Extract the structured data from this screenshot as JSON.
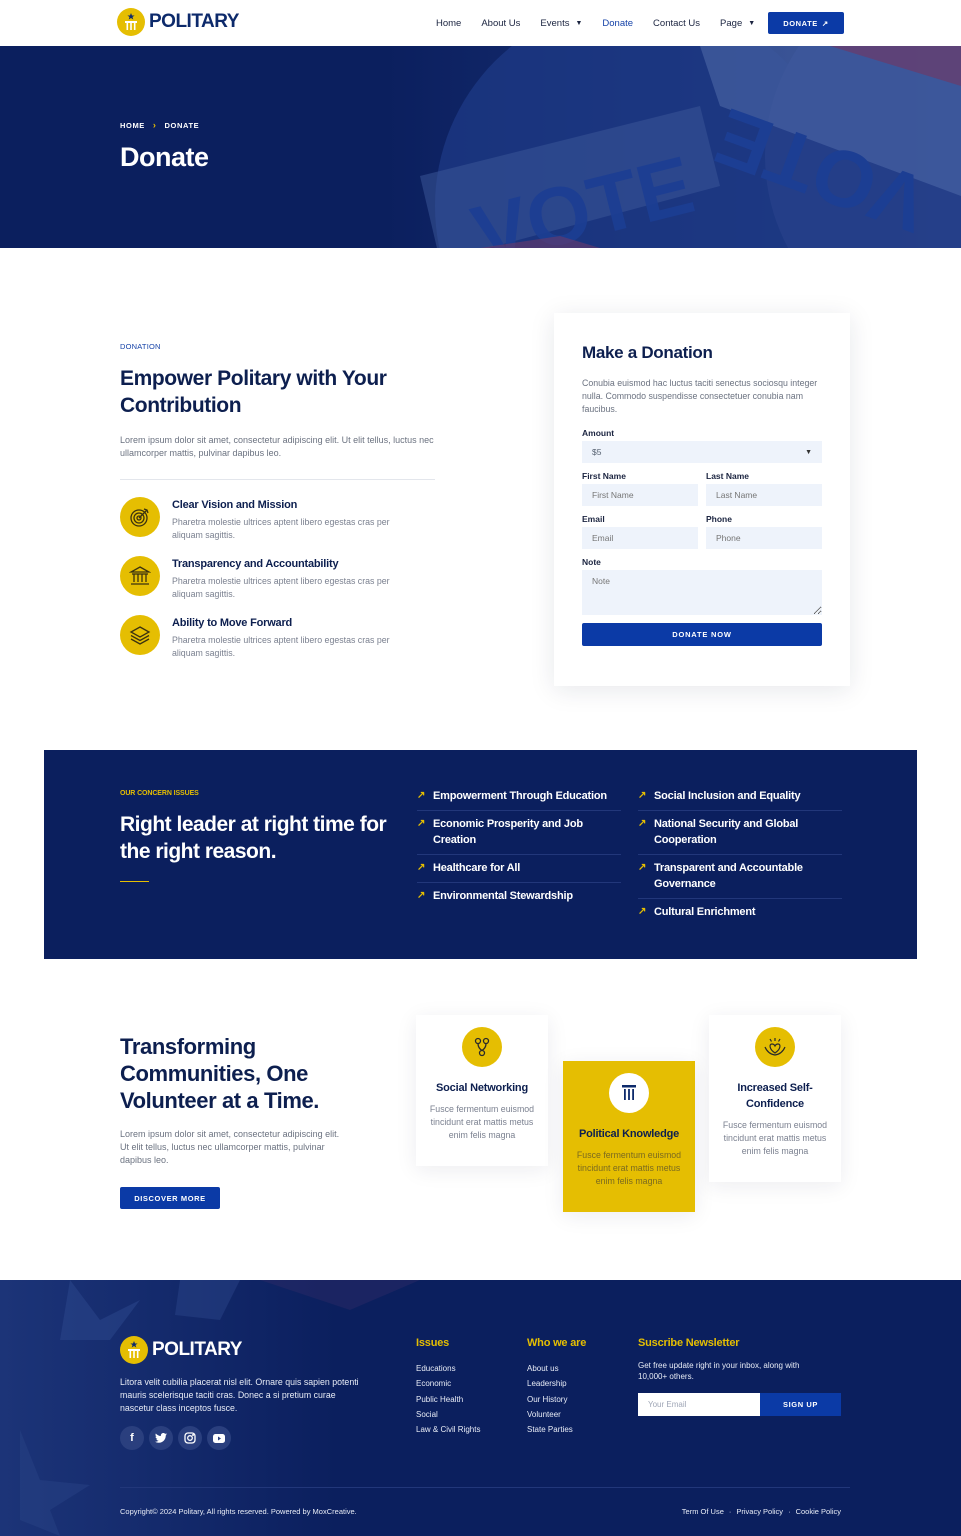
{
  "header": {
    "brand": "POLITARY",
    "nav": [
      {
        "label": "Home",
        "dropdown": false,
        "active": false
      },
      {
        "label": "About Us",
        "dropdown": false,
        "active": false
      },
      {
        "label": "Events",
        "dropdown": true,
        "active": false
      },
      {
        "label": "Donate",
        "dropdown": false,
        "active": true
      },
      {
        "label": "Contact Us",
        "dropdown": false,
        "active": false
      },
      {
        "label": "Page",
        "dropdown": true,
        "active": false
      }
    ],
    "cta_label": "DONATE",
    "cta_icon": "arrow-up-right-icon"
  },
  "hero": {
    "breadcrumb": [
      "HOME",
      "DONATE"
    ],
    "title": "Donate",
    "background": "vote-buttons-photo"
  },
  "donation": {
    "eyebrow": "DONATION",
    "title": "Empower Politary with Your Contribution",
    "description": "Lorem ipsum dolor sit amet, consectetur adipiscing elit. Ut elit tellus, luctus nec ullamcorper mattis, pulvinar dapibus leo.",
    "features": [
      {
        "icon": "target-icon",
        "title": "Clear Vision and Mission",
        "description": "Pharetra molestie ultrices aptent libero egestas cras per aliquam sagittis."
      },
      {
        "icon": "building-columns-icon",
        "title": "Transparency and Accountability",
        "description": "Pharetra molestie ultrices aptent libero egestas cras per aliquam sagittis."
      },
      {
        "icon": "layers-icon",
        "title": "Ability to Move Forward",
        "description": "Pharetra molestie ultrices aptent libero egestas cras per aliquam sagittis."
      }
    ]
  },
  "form": {
    "title": "Make a Donation",
    "description": "Conubia euismod hac luctus taciti senectus sociosqu integer nulla. Commodo suspendisse consectetuer conubia nam faucibus.",
    "amount_label": "Amount",
    "amount_value": "$5",
    "first_name_label": "First Name",
    "first_name_placeholder": "First Name",
    "last_name_label": "Last Name",
    "last_name_placeholder": "Last Name",
    "email_label": "Email",
    "email_placeholder": "Email",
    "phone_label": "Phone",
    "phone_placeholder": "Phone",
    "note_label": "Note",
    "note_placeholder": "Note",
    "submit_label": "DONATE NOW"
  },
  "concern": {
    "eyebrow": "OUR CONCERN ISSUES",
    "title": "Right leader at right time for the right reason.",
    "issues_left": [
      "Empowerment Through Education",
      "Economic Prosperity and Job Creation",
      "Healthcare for All",
      "Environmental Stewardship"
    ],
    "issues_right": [
      "Social Inclusion and Equality",
      "National Security and Global Cooperation",
      "Transparent and Accountable Governance",
      "Cultural Enrichment"
    ],
    "arrow_icon": "↗"
  },
  "volunteer": {
    "title": "Transforming Communities, One Volunteer at a Time.",
    "description": "Lorem ipsum dolor sit amet, consectetur adipiscing elit. Ut elit tellus, luctus nec ullamcorper mattis, pulvinar dapibus leo.",
    "button_label": "DISCOVER MORE",
    "cards": [
      {
        "icon": "network-icon",
        "title": "Social Networking",
        "description": "Fusce fermentum euismod tincidunt erat mattis metus enim felis magna",
        "highlighted": false
      },
      {
        "icon": "pillar-icon",
        "title": "Political Knowledge",
        "description": "Fusce fermentum euismod tincidunt erat mattis metus enim felis magna",
        "highlighted": true
      },
      {
        "icon": "heart-hands-icon",
        "title": "Increased Self-Confidence",
        "description": "Fusce fermentum euismod tincidunt erat mattis metus enim felis magna",
        "highlighted": false
      }
    ]
  },
  "footer": {
    "brand": "POLITARY",
    "about": "Litora velit cubilia placerat nisl elit. Ornare quis sapien potenti mauris scelerisque taciti cras. Donec a si pretium curae nascetur class inceptos fusce.",
    "socials": [
      {
        "name": "facebook-icon",
        "glyph": "f"
      },
      {
        "name": "twitter-icon",
        "glyph": "t"
      },
      {
        "name": "instagram-icon",
        "glyph": "◎"
      },
      {
        "name": "youtube-icon",
        "glyph": "▶"
      }
    ],
    "issues_title": "Issues",
    "issues_links": [
      "Educations",
      "Economic",
      "Public Health",
      "Social",
      "Law & Civil Rights"
    ],
    "who_title": "Who we are",
    "who_links": [
      "About us",
      "Leadership",
      "Our History",
      "Volunteer",
      "State Parties"
    ],
    "newsletter_title": "Suscribe Newsletter",
    "newsletter_text": "Get free update right in your inbox, along with 10,000+ others.",
    "newsletter_placeholder": "Your Email",
    "newsletter_button": "SIGN UP",
    "copyright": "Copyright© 2024 Politary, All rights reserved. Powered by MoxCreative.",
    "legal_links": [
      "Term Of Use",
      "Privacy Policy",
      "Cookie Policy"
    ],
    "legal_separator": "·"
  },
  "colors": {
    "navy": "#0b1f5e",
    "primary_blue": "#0b3aa6",
    "accent_yellow": "#e5be02",
    "heading": "#0d1f4f",
    "field_bg": "#eef3fb"
  }
}
